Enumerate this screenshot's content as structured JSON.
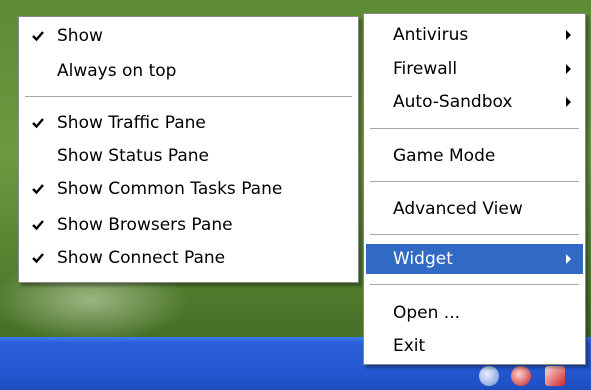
{
  "main_menu": {
    "items": [
      {
        "label": "Antivirus",
        "has_submenu": true
      },
      {
        "label": "Firewall",
        "has_submenu": true
      },
      {
        "label": "Auto-Sandbox",
        "has_submenu": true
      },
      {
        "label": "Game Mode"
      },
      {
        "label": "Advanced View"
      },
      {
        "label": "Widget",
        "has_submenu": true,
        "highlighted": true
      },
      {
        "label": "Open ..."
      },
      {
        "label": "Exit"
      }
    ]
  },
  "widget_submenu": {
    "items": [
      {
        "label": "Show",
        "checked": true
      },
      {
        "label": "Always on top",
        "checked": false
      },
      {
        "label": "Show Traffic Pane",
        "checked": true
      },
      {
        "label": "Show Status Pane",
        "checked": false
      },
      {
        "label": "Show Common Tasks Pane",
        "checked": true
      },
      {
        "label": "Show Browsers Pane",
        "checked": true
      },
      {
        "label": "Show Connect Pane",
        "checked": true
      }
    ]
  },
  "colors": {
    "highlight": "#316ac5",
    "menu_background": "#ffffff",
    "taskbar": "#2458d2"
  },
  "icons": {
    "check": "checkmark-icon",
    "submenu": "chevron-right-icon"
  }
}
